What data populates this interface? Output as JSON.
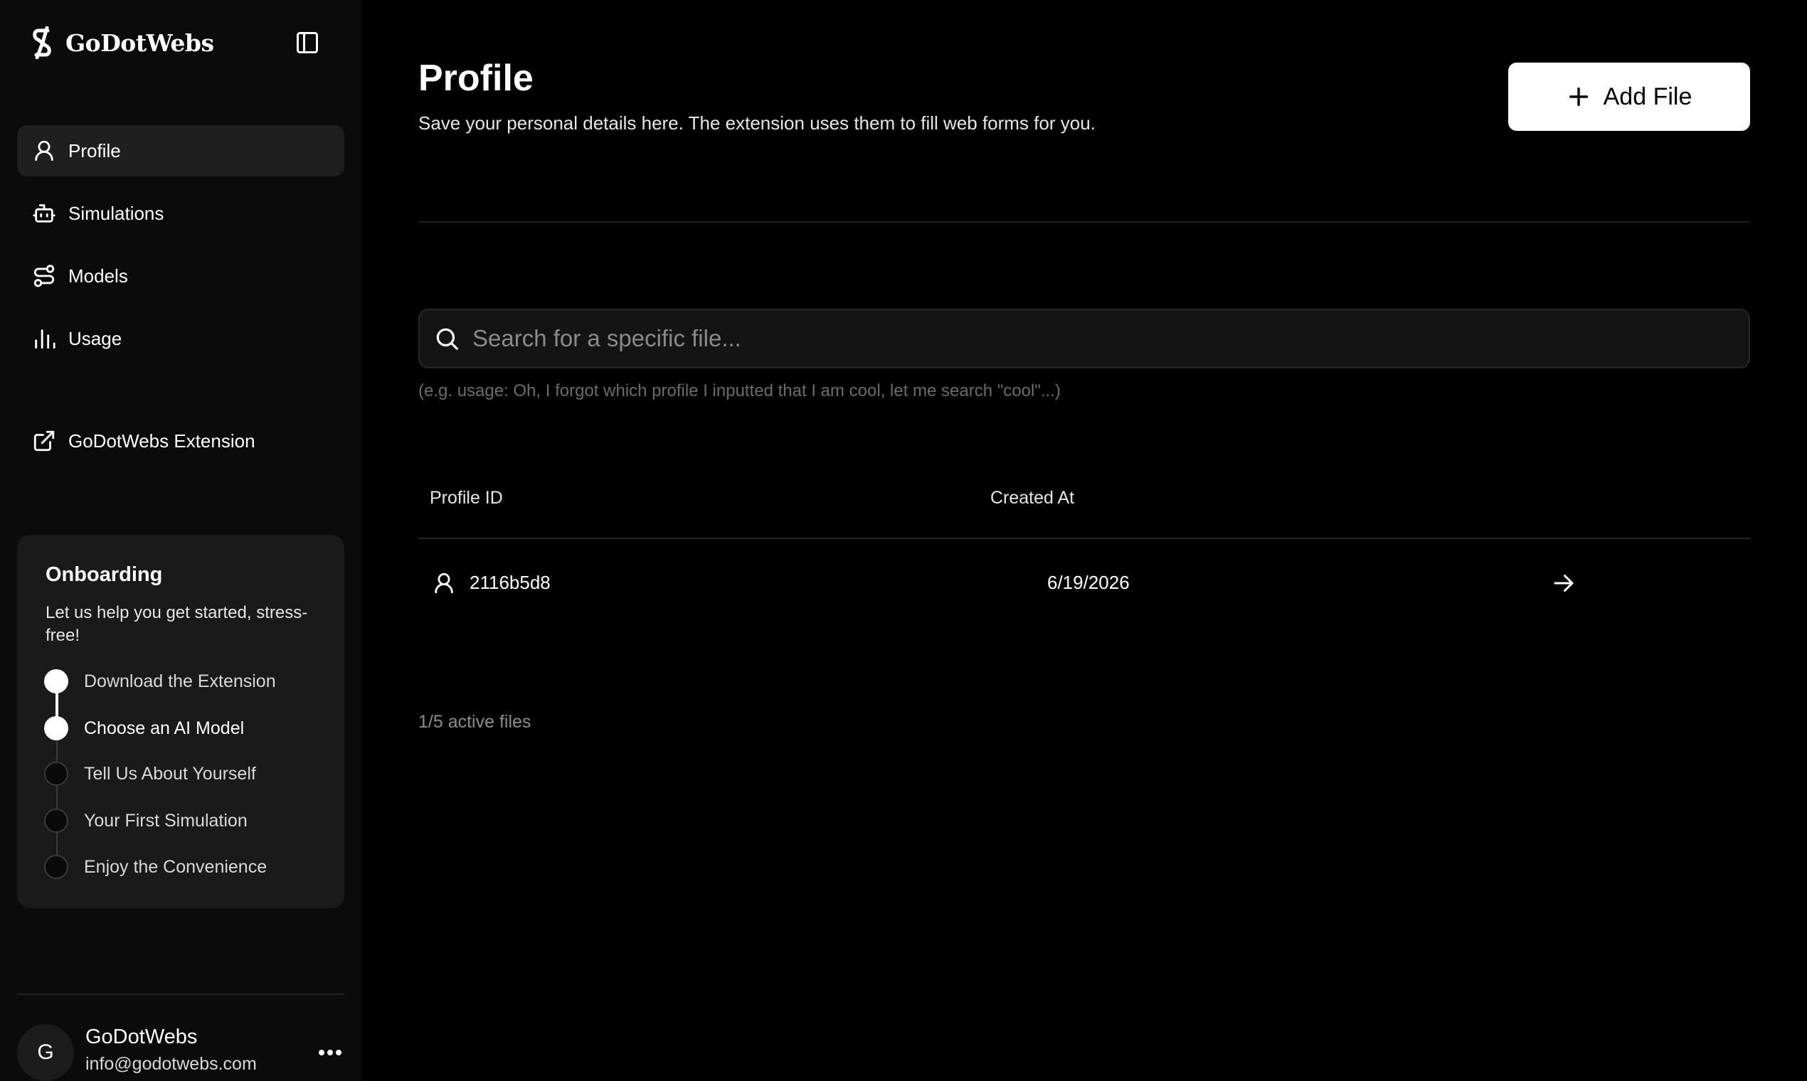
{
  "brand": {
    "name": "GoDotWebs",
    "logo_icon": "godotwebs-logo-icon"
  },
  "sidebar": {
    "toggle_icon": "sidebar-panel-icon",
    "nav_items": [
      {
        "label": "Profile",
        "icon": "user-icon",
        "active": true
      },
      {
        "label": "Simulations",
        "icon": "robot-icon",
        "active": false
      },
      {
        "label": "Models",
        "icon": "route-icon",
        "active": false
      },
      {
        "label": "Usage",
        "icon": "bar-chart-icon",
        "active": false
      }
    ],
    "extension_link": {
      "label": "GoDotWebs Extension",
      "icon": "external-link-icon"
    },
    "onboarding": {
      "title": "Onboarding",
      "description": "Let us help you get started, stress-free!",
      "steps": [
        {
          "label": "Download the Extension",
          "done": true
        },
        {
          "label": "Choose an AI Model",
          "done": true
        },
        {
          "label": "Tell Us About Yourself",
          "done": false
        },
        {
          "label": "Your First Simulation",
          "done": false
        },
        {
          "label": "Enjoy the Convenience",
          "done": false
        }
      ]
    },
    "user": {
      "avatar_initial": "G",
      "name": "GoDotWebs",
      "email": "info@godotwebs.com",
      "menu_icon": "more-horizontal-icon"
    }
  },
  "main": {
    "title": "Profile",
    "subtitle": "Save your personal details here. The extension uses them to fill web forms for you.",
    "add_button": {
      "label": "Add File",
      "icon": "plus-icon"
    },
    "search": {
      "placeholder": "Search for a specific file...",
      "value": "",
      "hint": "(e.g. usage: Oh, I forgot which profile I inputted that I am cool, let me search \"cool\"...)",
      "icon": "search-icon"
    },
    "table": {
      "columns": [
        "Profile ID",
        "Created At"
      ],
      "rows": [
        {
          "profile_id": "2116b5d8",
          "created_at": "6/19/2026",
          "icon": "user-icon",
          "action_icon": "arrow-right-icon"
        }
      ]
    },
    "footer_count": "1/5 active files"
  },
  "colors": {
    "background": "#000000",
    "sidebar_bg": "#0b0b0b",
    "active_nav_bg": "#1f1f1f",
    "card_bg": "#1a1a1a",
    "primary_button_bg": "#ffffff",
    "primary_button_text": "#000000",
    "muted_text": "#8c8c8c"
  }
}
